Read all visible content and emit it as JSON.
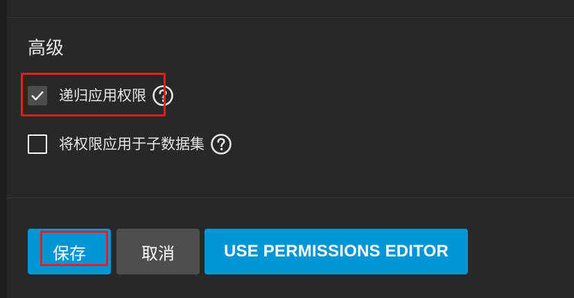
{
  "section": {
    "title": "高级"
  },
  "options": [
    {
      "label": "递归应用权限",
      "checked": true,
      "icon": "help-circle-icon"
    },
    {
      "label": "将权限应用于子数据集",
      "checked": false,
      "icon": "help-circle-icon"
    }
  ],
  "buttons": {
    "save_label": "保存",
    "cancel_label": "取消",
    "permissions_editor_label": "USE PERMISSIONS EDITOR"
  },
  "colors": {
    "primary": "#0095d5",
    "secondary": "#4e4e4e",
    "highlight": "#e8201c",
    "background": "#282828"
  }
}
